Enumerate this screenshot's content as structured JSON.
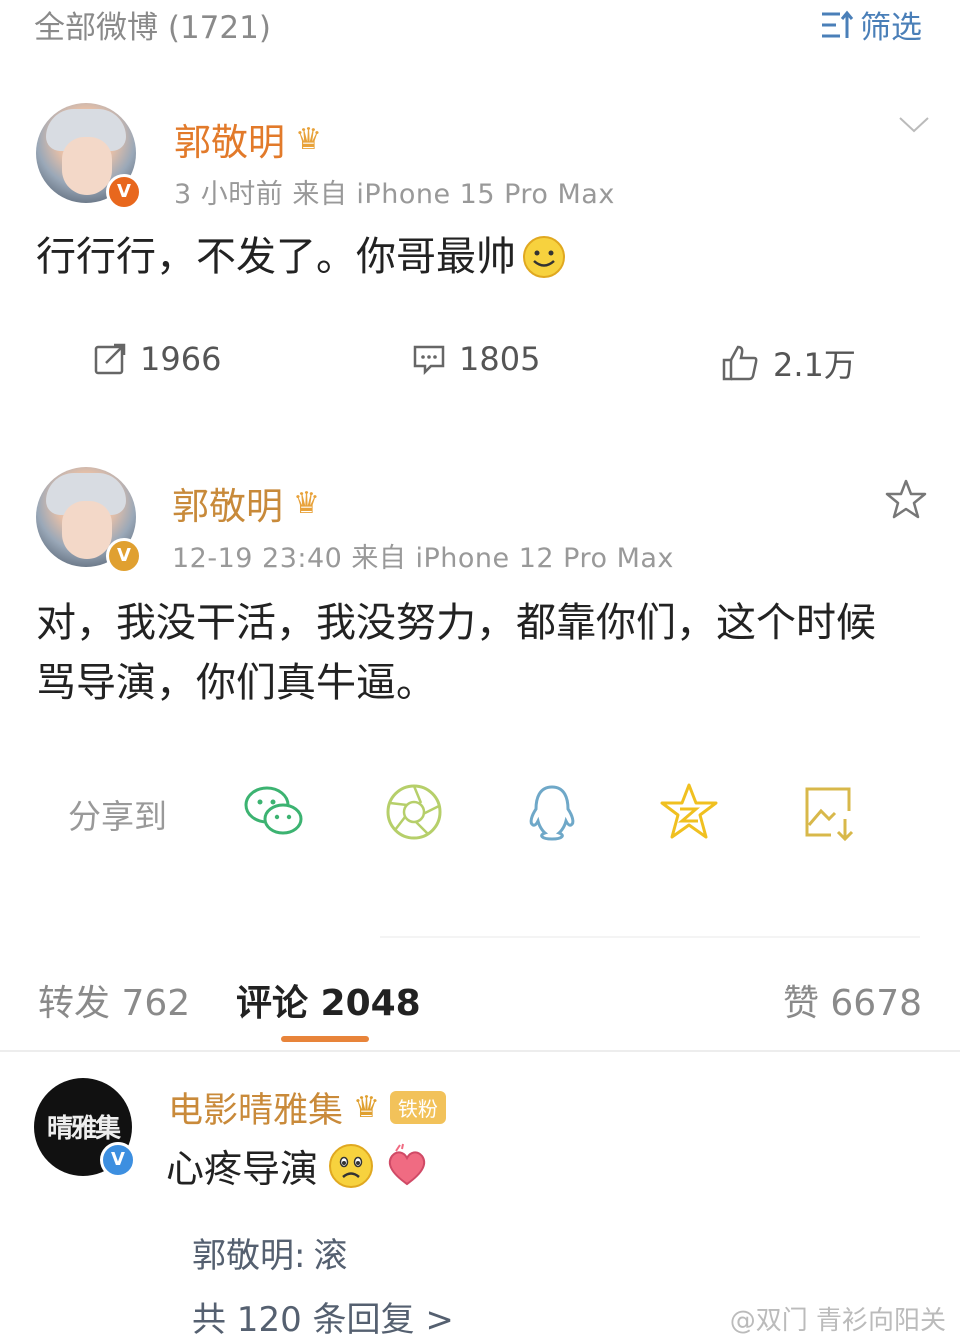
{
  "header": {
    "title": "全部微博 (1721)",
    "filter_label": "筛选"
  },
  "post1": {
    "username": "郭敬明",
    "meta": "3 小时前   来自 iPhone 15 Pro Max",
    "text": "行行行，不发了。你哥最帅",
    "actions": {
      "repost": "1966",
      "comment": "1805",
      "like": "2.1万"
    }
  },
  "post2": {
    "username": "郭敬明",
    "meta": "12-19 23:40   来自 iPhone 12 Pro Max",
    "text_line1": "对，我没干活，我没努力，都靠你们，这个时候",
    "text_line2": "骂导演，你们真牛逼。",
    "share_label": "分享到"
  },
  "tabs": {
    "repost": "转发 762",
    "comment": "评论 2048",
    "like": "赞 6678"
  },
  "comment": {
    "username": "电影晴雅集",
    "fan_badge": "铁粉",
    "avatar_text": "晴雅集",
    "text": "心疼导演",
    "reply_author": "郭敬明:",
    "reply_text": "滚",
    "reply_count": "共 120 条回复 >"
  },
  "watermark": "@双门 青衫向阳关",
  "colors": {
    "accent": "#e8843a",
    "username": "#e27a2a",
    "link": "#4a7fb8"
  }
}
